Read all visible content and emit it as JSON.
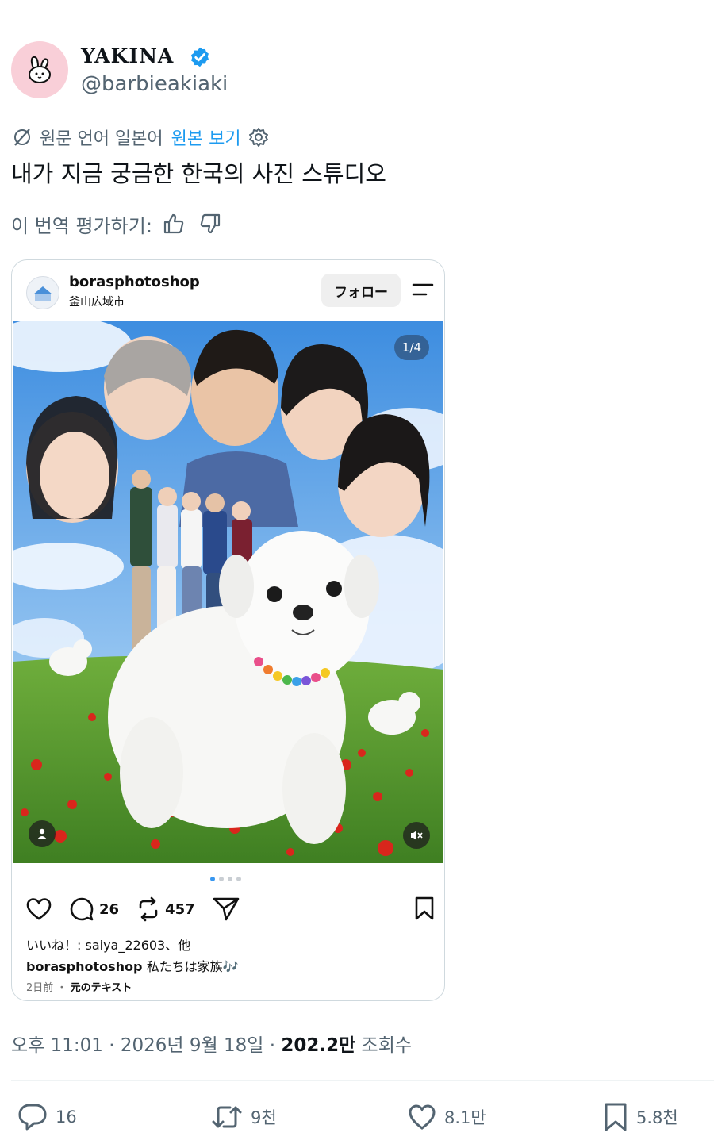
{
  "author": {
    "display_name": "YAKINA",
    "handle": "@barbieakiaki",
    "avatar": "bunny-icon",
    "verified": true,
    "verified_color": "#1d9bf0"
  },
  "translation": {
    "note": "원문 언어 일본어",
    "show_original": "원본 보기"
  },
  "tweet": {
    "text": "내가 지금 궁금한 한국의 사진 스튜디오",
    "rate_label": "이 번역 평가하기:"
  },
  "embed": {
    "username": "borasphotoshop",
    "location": "釜山広域市",
    "follow_label": "フォロー",
    "counter": "1/4",
    "comments": "26",
    "reposts": "457",
    "likes_line": "いいね！: saiya_22603、他",
    "caption_user": "borasphotoshop",
    "caption_text": "私たちは家族🎶",
    "time_ago": "2日前",
    "separator": "・",
    "see_original": "元のテキスト"
  },
  "footer": {
    "time": "오후 11:01 · 2026년 9월 18일 · ",
    "views": "202.2만",
    "views_label": " 조회수"
  },
  "stats": {
    "replies": "16",
    "retweets": "9천",
    "likes": "8.1만",
    "bookmarks": "5.8천"
  }
}
